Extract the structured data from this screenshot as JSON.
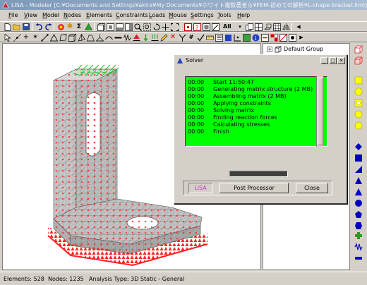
{
  "window": {
    "title": "LISA - Modeler [C:¥Documents and Settings¥akira¥My Documents¥ホワイト複数著者ら¥FEM-初めての解析¥L-shape bracket.liml]"
  },
  "menu": [
    "File",
    "View",
    "Model",
    "Nodes",
    "Elements",
    "Constraints",
    "Loads",
    "Mouse",
    "Settings",
    "Tools",
    "Help"
  ],
  "toolbar": {
    "all_label": "All"
  },
  "tree": {
    "expander": "+",
    "root_label": "Default Group"
  },
  "solver": {
    "title": "Solver",
    "log": [
      {
        "time": "00:00",
        "message": "Start 11:50:47"
      },
      {
        "time": "00:00",
        "message": "Generating matrix structure (2 MB)"
      },
      {
        "time": "00:00",
        "message": "Assembling matrix (2 MB)"
      },
      {
        "time": "00:00",
        "message": "Applying constraints"
      },
      {
        "time": "00:00",
        "message": "Solving matrix"
      },
      {
        "time": "00:00",
        "message": "Finding reaction forces"
      },
      {
        "time": "00:00",
        "message": "Calculating stresses"
      },
      {
        "time": "00:00",
        "message": "Finish"
      }
    ],
    "lisa_label": "LISA",
    "post_processor_label": "Post Processor",
    "close_label": "Close",
    "log_color": "#00ff00"
  },
  "status": {
    "elements": "Elements: 528",
    "nodes": "Nodes: 1235",
    "analysis": "Analysis Type: 3D Static - General"
  },
  "colors": {
    "constraint": "#ff2020",
    "load": "#20c020",
    "mesh_edge": "#606060",
    "palette_yellow": "#ffff00",
    "palette_blue": "#0000c0"
  }
}
